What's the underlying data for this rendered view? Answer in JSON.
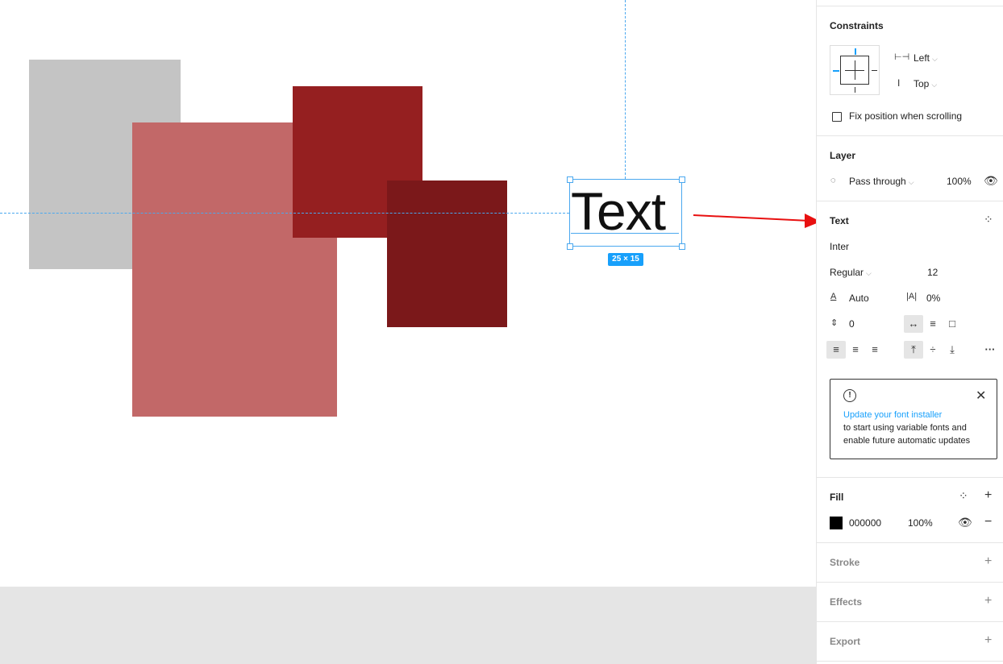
{
  "canvas": {
    "shapes": [
      {
        "name": "gray-rectangle",
        "color": "#c4c4c4"
      },
      {
        "name": "pink-rectangle",
        "color": "#c26868"
      },
      {
        "name": "red-rectangle",
        "color": "#951f20"
      },
      {
        "name": "dark-red-rectangle",
        "color": "#7b181a"
      }
    ],
    "selected_text": "Text",
    "dimensions_badge": "25 × 15",
    "selection_color": "#4aa8ef",
    "arrow_color": "#e81010"
  },
  "panel": {
    "constraints": {
      "title": "Constraints",
      "horizontal": "Left",
      "vertical": "Top",
      "fix_position_label": "Fix position when scrolling"
    },
    "layer": {
      "title": "Layer",
      "blend_mode": "Pass through",
      "opacity": "100%"
    },
    "text": {
      "title": "Text",
      "font_family": "Inter",
      "font_weight": "Regular",
      "font_size": "12",
      "line_height": "Auto",
      "letter_spacing": "0%",
      "paragraph_spacing": "0"
    },
    "notice": {
      "link": "Update your font installer",
      "body_line1": "to start using variable fonts and",
      "body_line2": "enable future automatic updates"
    },
    "fill": {
      "title": "Fill",
      "hex": "000000",
      "opacity": "100%",
      "color": "#000000"
    },
    "stroke": {
      "title": "Stroke"
    },
    "effects": {
      "title": "Effects"
    },
    "export": {
      "title": "Export"
    }
  }
}
